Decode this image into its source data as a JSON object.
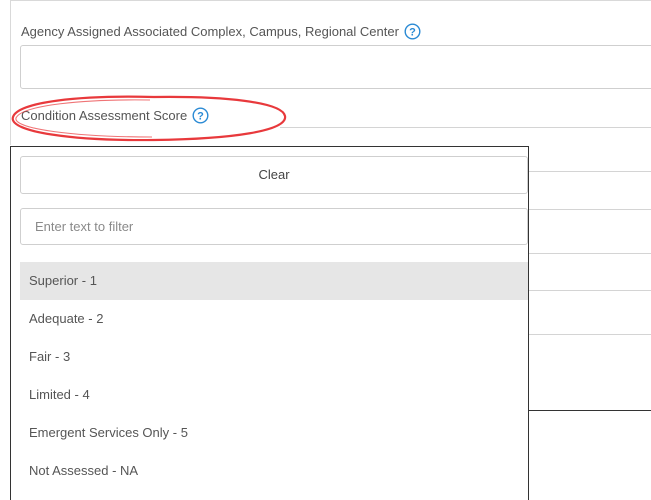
{
  "fields": {
    "agency_complex": {
      "label": "Agency Assigned Associated Complex, Campus, Regional Center",
      "help_icon": "question-circle-icon"
    },
    "condition_score": {
      "label": "Condition Assessment Score",
      "help_icon": "question-circle-icon",
      "highlight_color": "#e8393c"
    }
  },
  "dropdown": {
    "clear_label": "Clear",
    "filter_placeholder": "Enter text to filter",
    "options": [
      "Superior - 1",
      "Adequate - 2",
      "Fair - 3",
      "Limited - 4",
      "Emergent Services Only - 5",
      "Not Assessed - NA"
    ],
    "hovered_option": "Superior - 1"
  },
  "colors": {
    "label_text": "#555555",
    "help_icon": "#2a8ad4",
    "border": "#cfcfcf",
    "hover_bg": "#e6e6e6"
  }
}
